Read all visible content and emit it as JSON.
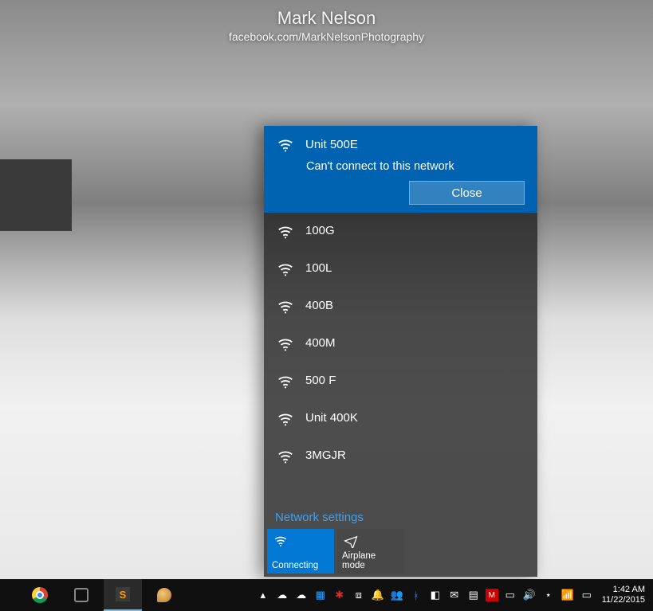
{
  "wallpaper": {
    "name": "Mark Nelson",
    "subtitle": "facebook.com/MarkNelsonPhotography"
  },
  "flyout": {
    "selected": {
      "ssid": "Unit 500E",
      "message": "Can't connect to this network",
      "close_label": "Close"
    },
    "networks": [
      {
        "ssid": "100G"
      },
      {
        "ssid": "100L"
      },
      {
        "ssid": "400B"
      },
      {
        "ssid": "400M"
      },
      {
        "ssid": "500 F"
      },
      {
        "ssid": "Unit 400K"
      },
      {
        "ssid": "3MGJR"
      }
    ],
    "settings_label": "Network settings",
    "tiles": {
      "wifi": {
        "label": "Connecting",
        "active": true
      },
      "airplane": {
        "label": "Airplane mode",
        "active": false
      }
    }
  },
  "taskbar": {
    "apps": [
      {
        "name": "chrome",
        "icon": "chrome-icon"
      },
      {
        "name": "settings",
        "icon": "gear-icon"
      },
      {
        "name": "sublime-text",
        "icon": "sublime-icon",
        "active": true
      },
      {
        "name": "paint",
        "icon": "paint-icon"
      }
    ],
    "tray": [
      {
        "name": "show-hidden-icons",
        "glyph": "▴"
      },
      {
        "name": "onedrive-icon",
        "glyph": "☁"
      },
      {
        "name": "onedrive-personal",
        "glyph": "☁"
      },
      {
        "name": "intel-graphics-icon",
        "glyph": "▦"
      },
      {
        "name": "lastpass-icon",
        "glyph": "✱"
      },
      {
        "name": "dropbox-icon",
        "glyph": "⧈"
      },
      {
        "name": "notifications-bell",
        "glyph": "🔔"
      },
      {
        "name": "people-icon",
        "glyph": "👥"
      },
      {
        "name": "bluetooth-icon",
        "glyph": "ᚼ"
      },
      {
        "name": "windows-update-icon",
        "glyph": "◧"
      },
      {
        "name": "mail-icon",
        "glyph": "✉"
      },
      {
        "name": "task-manager-icon",
        "glyph": "▤"
      },
      {
        "name": "mcafee-icon",
        "glyph": "M"
      },
      {
        "name": "battery-icon",
        "glyph": "▭"
      },
      {
        "name": "volume-icon",
        "glyph": "🔊"
      },
      {
        "name": "network-icon",
        "glyph": "⋆"
      },
      {
        "name": "wifi-tray-icon",
        "glyph": "📶"
      },
      {
        "name": "action-center-icon",
        "glyph": "▭"
      }
    ],
    "clock": {
      "time": "1:42 AM",
      "date": "11/22/2015"
    }
  }
}
